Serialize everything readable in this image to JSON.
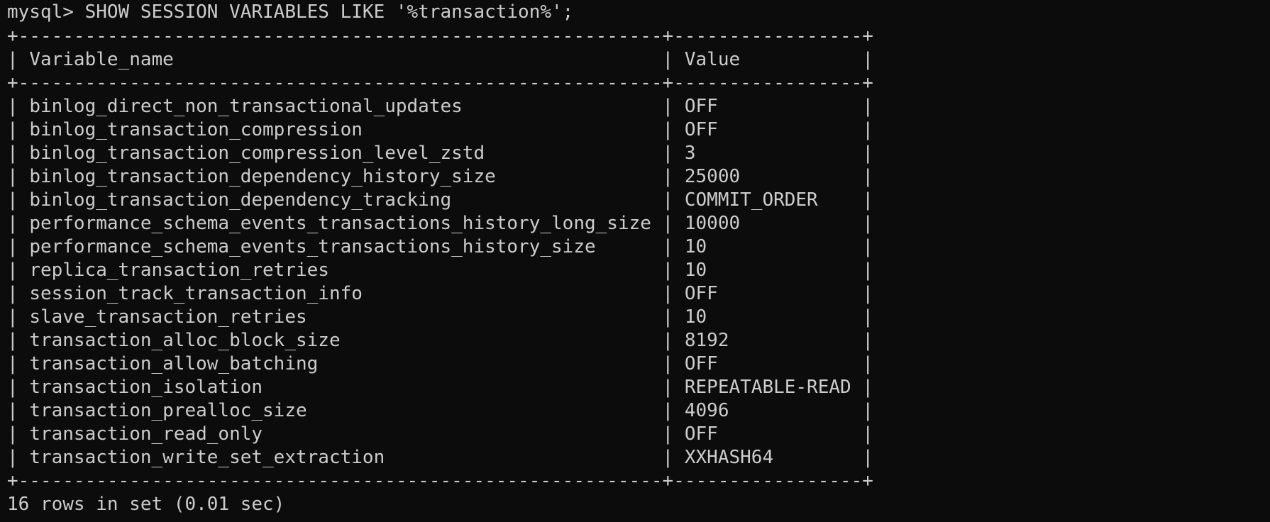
{
  "prompt": "mysql> ",
  "command": "SHOW SESSION VARIABLES LIKE '%transaction%';",
  "table": {
    "columns": [
      "Variable_name",
      "Value"
    ],
    "rows": [
      [
        "binlog_direct_non_transactional_updates",
        "OFF"
      ],
      [
        "binlog_transaction_compression",
        "OFF"
      ],
      [
        "binlog_transaction_compression_level_zstd",
        "3"
      ],
      [
        "binlog_transaction_dependency_history_size",
        "25000"
      ],
      [
        "binlog_transaction_dependency_tracking",
        "COMMIT_ORDER"
      ],
      [
        "performance_schema_events_transactions_history_long_size",
        "10000"
      ],
      [
        "performance_schema_events_transactions_history_size",
        "10"
      ],
      [
        "replica_transaction_retries",
        "10"
      ],
      [
        "session_track_transaction_info",
        "OFF"
      ],
      [
        "slave_transaction_retries",
        "10"
      ],
      [
        "transaction_alloc_block_size",
        "8192"
      ],
      [
        "transaction_allow_batching",
        "OFF"
      ],
      [
        "transaction_isolation",
        "REPEATABLE-READ"
      ],
      [
        "transaction_prealloc_size",
        "4096"
      ],
      [
        "transaction_read_only",
        "OFF"
      ],
      [
        "transaction_write_set_extraction",
        "XXHASH64"
      ]
    ]
  },
  "summary": "16 rows in set (0.01 sec)",
  "colors": {
    "background": "#0c0c0c",
    "text": "#cccccc"
  }
}
